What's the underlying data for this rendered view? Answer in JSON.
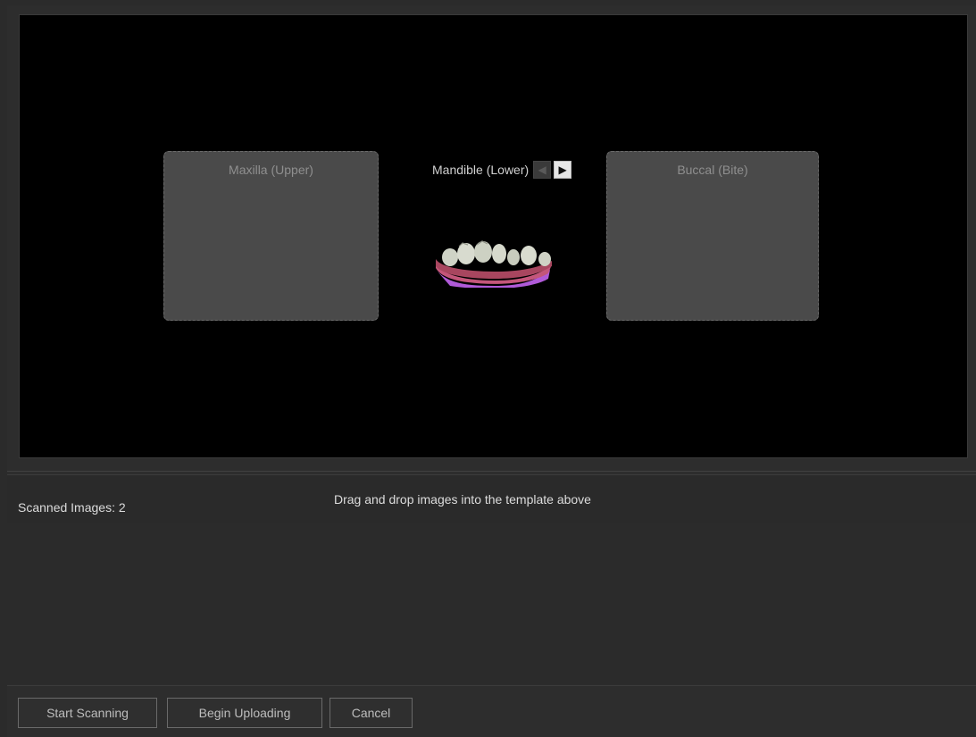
{
  "template": {
    "slots": {
      "upper": {
        "label": "Maxilla (Upper)"
      },
      "lower": {
        "label": "Mandible (Lower)"
      },
      "buccal": {
        "label": "Buccal (Bite)"
      }
    },
    "nav_prev_icon": "left-triangle-icon",
    "nav_next_icon": "right-triangle-icon",
    "scan_thumbnail": "lower-jaw-3d-scan"
  },
  "status": {
    "scanned_count_text": "Scanned Images: 2",
    "hint_text": "Drag and drop images into the template above"
  },
  "buttons": {
    "start_scanning": "Start Scanning",
    "begin_uploading": "Begin Uploading",
    "cancel": "Cancel"
  },
  "colors": {
    "background": "#2b2b2b",
    "template_bg": "#000000",
    "slot_bg": "#4a4a4a",
    "gum_pink": "#c4567a",
    "gum_purple": "#b05ad8",
    "tooth": "#cfd3c6"
  }
}
